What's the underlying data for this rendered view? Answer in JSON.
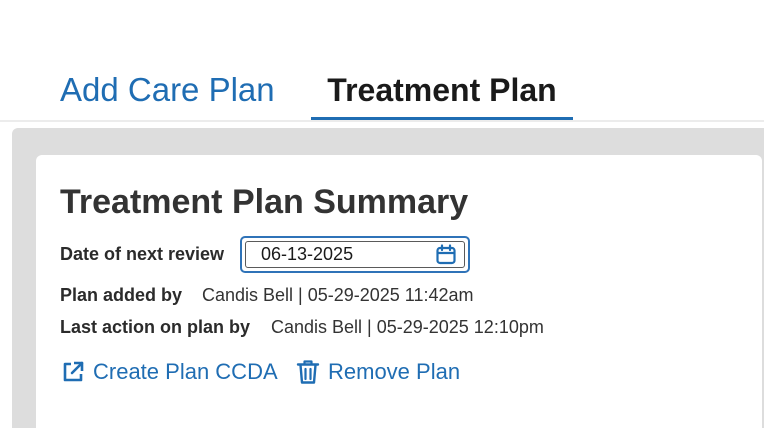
{
  "tabs": {
    "add_care_plan": "Add Care Plan",
    "treatment_plan": "Treatment Plan"
  },
  "summary": {
    "title": "Treatment Plan Summary",
    "next_review_label": "Date of next review",
    "next_review_value": "06-13-2025",
    "plan_added_label": "Plan added by",
    "plan_added_value": "Candis Bell | 05-29-2025 11:42am",
    "last_action_label": "Last action on plan by",
    "last_action_value": "Candis Bell | 05-29-2025 12:10pm"
  },
  "actions": {
    "create_ccda": "Create Plan CCDA",
    "remove_plan": "Remove Plan"
  },
  "icons": {
    "calendar": "calendar-icon",
    "external_link": "external-link-icon",
    "trash": "trash-icon"
  },
  "colors": {
    "accent": "#1f6db3",
    "panel_background": "#dddddd"
  }
}
